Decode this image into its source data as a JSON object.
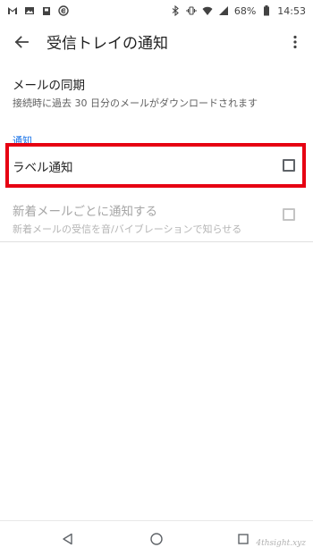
{
  "status_bar": {
    "battery": "68%",
    "time": "14:53",
    "left_icons": [
      "gmail-icon",
      "image-icon",
      "android-icon",
      "e-icon"
    ],
    "right_icons": [
      "bluetooth-icon",
      "vibrate-icon",
      "wifi-icon",
      "signal-icon",
      "battery-icon"
    ]
  },
  "app_bar": {
    "title": "受信トレイの通知"
  },
  "sync": {
    "title": "メールの同期",
    "summary": "接続時に過去 30 日分のメールがダウンロードされます"
  },
  "category": "通知",
  "label_notification": {
    "title": "ラベル通知",
    "checked": false,
    "highlighted": true,
    "highlight_color": "#e60012"
  },
  "new_mail": {
    "title": "新着メールごとに通知する",
    "summary": "新着メールの受信を音/バイブレーションで知らせる",
    "checked": false,
    "enabled": false
  },
  "nav": {
    "buttons": [
      "back-triangle-icon",
      "home-circle-icon",
      "recents-square-icon"
    ]
  },
  "watermark": "4thsight.xyz",
  "colors": {
    "accent": "#1a73e8",
    "highlight": "#e60012"
  }
}
